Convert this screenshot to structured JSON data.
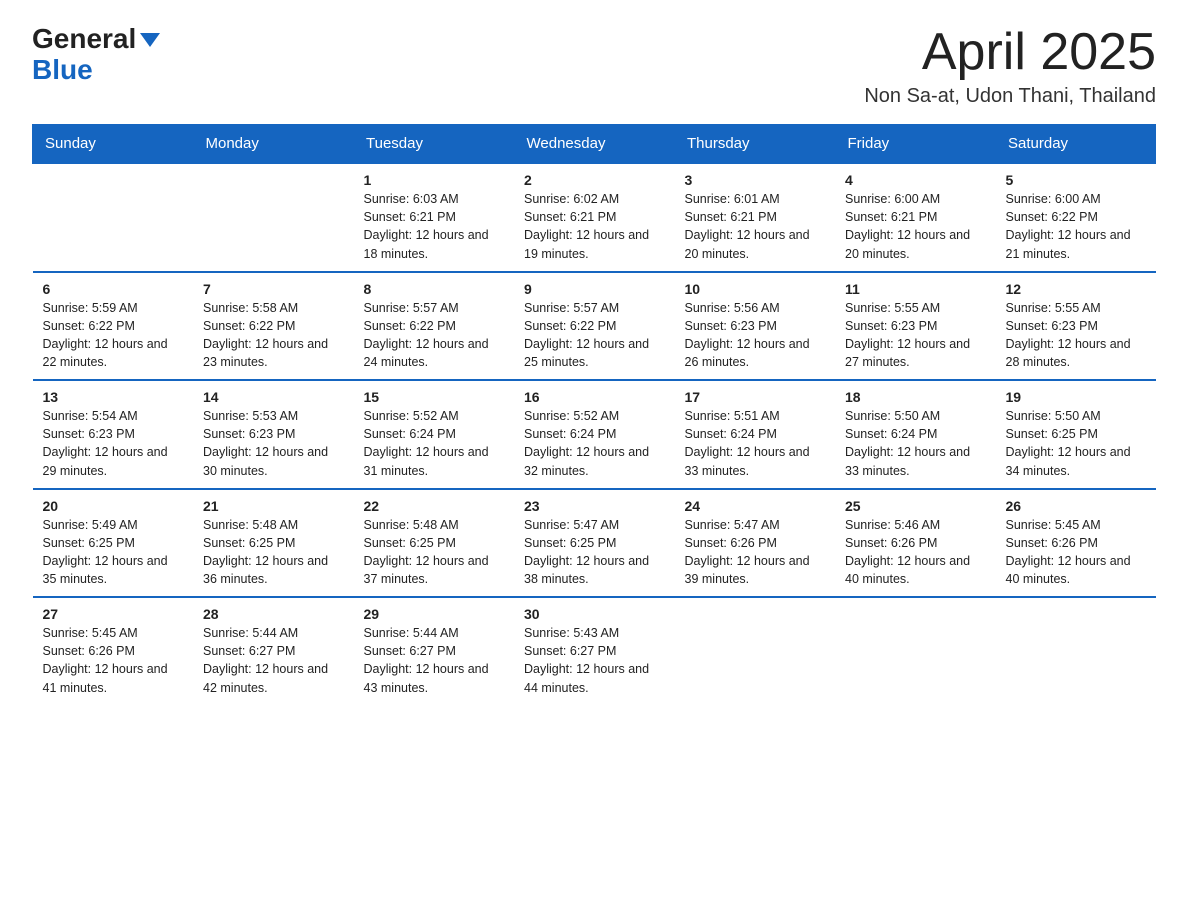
{
  "logo": {
    "general": "General",
    "blue": "Blue"
  },
  "title": {
    "month_year": "April 2025",
    "location": "Non Sa-at, Udon Thani, Thailand"
  },
  "headers": [
    "Sunday",
    "Monday",
    "Tuesday",
    "Wednesday",
    "Thursday",
    "Friday",
    "Saturday"
  ],
  "weeks": [
    [
      {
        "day": "",
        "sunrise": "",
        "sunset": "",
        "daylight": ""
      },
      {
        "day": "",
        "sunrise": "",
        "sunset": "",
        "daylight": ""
      },
      {
        "day": "1",
        "sunrise": "Sunrise: 6:03 AM",
        "sunset": "Sunset: 6:21 PM",
        "daylight": "Daylight: 12 hours and 18 minutes."
      },
      {
        "day": "2",
        "sunrise": "Sunrise: 6:02 AM",
        "sunset": "Sunset: 6:21 PM",
        "daylight": "Daylight: 12 hours and 19 minutes."
      },
      {
        "day": "3",
        "sunrise": "Sunrise: 6:01 AM",
        "sunset": "Sunset: 6:21 PM",
        "daylight": "Daylight: 12 hours and 20 minutes."
      },
      {
        "day": "4",
        "sunrise": "Sunrise: 6:00 AM",
        "sunset": "Sunset: 6:21 PM",
        "daylight": "Daylight: 12 hours and 20 minutes."
      },
      {
        "day": "5",
        "sunrise": "Sunrise: 6:00 AM",
        "sunset": "Sunset: 6:22 PM",
        "daylight": "Daylight: 12 hours and 21 minutes."
      }
    ],
    [
      {
        "day": "6",
        "sunrise": "Sunrise: 5:59 AM",
        "sunset": "Sunset: 6:22 PM",
        "daylight": "Daylight: 12 hours and 22 minutes."
      },
      {
        "day": "7",
        "sunrise": "Sunrise: 5:58 AM",
        "sunset": "Sunset: 6:22 PM",
        "daylight": "Daylight: 12 hours and 23 minutes."
      },
      {
        "day": "8",
        "sunrise": "Sunrise: 5:57 AM",
        "sunset": "Sunset: 6:22 PM",
        "daylight": "Daylight: 12 hours and 24 minutes."
      },
      {
        "day": "9",
        "sunrise": "Sunrise: 5:57 AM",
        "sunset": "Sunset: 6:22 PM",
        "daylight": "Daylight: 12 hours and 25 minutes."
      },
      {
        "day": "10",
        "sunrise": "Sunrise: 5:56 AM",
        "sunset": "Sunset: 6:23 PM",
        "daylight": "Daylight: 12 hours and 26 minutes."
      },
      {
        "day": "11",
        "sunrise": "Sunrise: 5:55 AM",
        "sunset": "Sunset: 6:23 PM",
        "daylight": "Daylight: 12 hours and 27 minutes."
      },
      {
        "day": "12",
        "sunrise": "Sunrise: 5:55 AM",
        "sunset": "Sunset: 6:23 PM",
        "daylight": "Daylight: 12 hours and 28 minutes."
      }
    ],
    [
      {
        "day": "13",
        "sunrise": "Sunrise: 5:54 AM",
        "sunset": "Sunset: 6:23 PM",
        "daylight": "Daylight: 12 hours and 29 minutes."
      },
      {
        "day": "14",
        "sunrise": "Sunrise: 5:53 AM",
        "sunset": "Sunset: 6:23 PM",
        "daylight": "Daylight: 12 hours and 30 minutes."
      },
      {
        "day": "15",
        "sunrise": "Sunrise: 5:52 AM",
        "sunset": "Sunset: 6:24 PM",
        "daylight": "Daylight: 12 hours and 31 minutes."
      },
      {
        "day": "16",
        "sunrise": "Sunrise: 5:52 AM",
        "sunset": "Sunset: 6:24 PM",
        "daylight": "Daylight: 12 hours and 32 minutes."
      },
      {
        "day": "17",
        "sunrise": "Sunrise: 5:51 AM",
        "sunset": "Sunset: 6:24 PM",
        "daylight": "Daylight: 12 hours and 33 minutes."
      },
      {
        "day": "18",
        "sunrise": "Sunrise: 5:50 AM",
        "sunset": "Sunset: 6:24 PM",
        "daylight": "Daylight: 12 hours and 33 minutes."
      },
      {
        "day": "19",
        "sunrise": "Sunrise: 5:50 AM",
        "sunset": "Sunset: 6:25 PM",
        "daylight": "Daylight: 12 hours and 34 minutes."
      }
    ],
    [
      {
        "day": "20",
        "sunrise": "Sunrise: 5:49 AM",
        "sunset": "Sunset: 6:25 PM",
        "daylight": "Daylight: 12 hours and 35 minutes."
      },
      {
        "day": "21",
        "sunrise": "Sunrise: 5:48 AM",
        "sunset": "Sunset: 6:25 PM",
        "daylight": "Daylight: 12 hours and 36 minutes."
      },
      {
        "day": "22",
        "sunrise": "Sunrise: 5:48 AM",
        "sunset": "Sunset: 6:25 PM",
        "daylight": "Daylight: 12 hours and 37 minutes."
      },
      {
        "day": "23",
        "sunrise": "Sunrise: 5:47 AM",
        "sunset": "Sunset: 6:25 PM",
        "daylight": "Daylight: 12 hours and 38 minutes."
      },
      {
        "day": "24",
        "sunrise": "Sunrise: 5:47 AM",
        "sunset": "Sunset: 6:26 PM",
        "daylight": "Daylight: 12 hours and 39 minutes."
      },
      {
        "day": "25",
        "sunrise": "Sunrise: 5:46 AM",
        "sunset": "Sunset: 6:26 PM",
        "daylight": "Daylight: 12 hours and 40 minutes."
      },
      {
        "day": "26",
        "sunrise": "Sunrise: 5:45 AM",
        "sunset": "Sunset: 6:26 PM",
        "daylight": "Daylight: 12 hours and 40 minutes."
      }
    ],
    [
      {
        "day": "27",
        "sunrise": "Sunrise: 5:45 AM",
        "sunset": "Sunset: 6:26 PM",
        "daylight": "Daylight: 12 hours and 41 minutes."
      },
      {
        "day": "28",
        "sunrise": "Sunrise: 5:44 AM",
        "sunset": "Sunset: 6:27 PM",
        "daylight": "Daylight: 12 hours and 42 minutes."
      },
      {
        "day": "29",
        "sunrise": "Sunrise: 5:44 AM",
        "sunset": "Sunset: 6:27 PM",
        "daylight": "Daylight: 12 hours and 43 minutes."
      },
      {
        "day": "30",
        "sunrise": "Sunrise: 5:43 AM",
        "sunset": "Sunset: 6:27 PM",
        "daylight": "Daylight: 12 hours and 44 minutes."
      },
      {
        "day": "",
        "sunrise": "",
        "sunset": "",
        "daylight": ""
      },
      {
        "day": "",
        "sunrise": "",
        "sunset": "",
        "daylight": ""
      },
      {
        "day": "",
        "sunrise": "",
        "sunset": "",
        "daylight": ""
      }
    ]
  ]
}
